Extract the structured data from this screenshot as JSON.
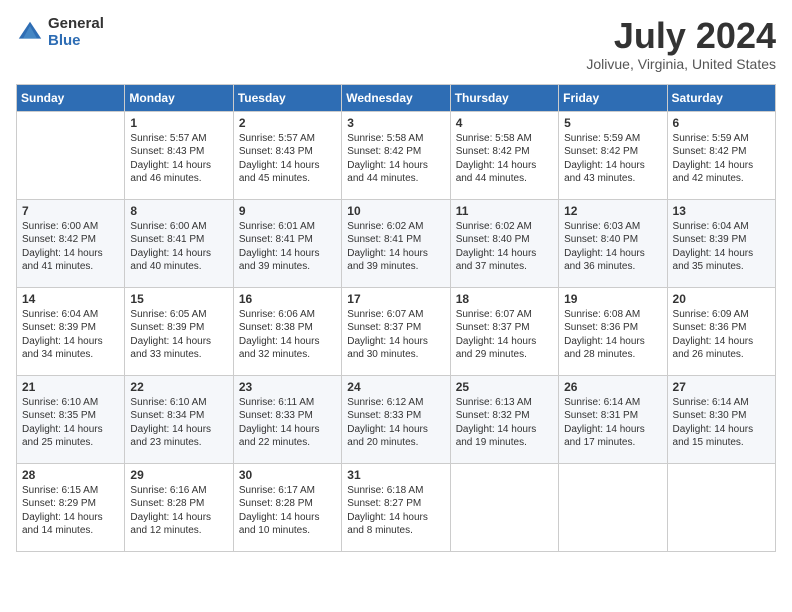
{
  "logo": {
    "text_general": "General",
    "text_blue": "Blue"
  },
  "title": "July 2024",
  "location": "Jolivue, Virginia, United States",
  "days_of_week": [
    "Sunday",
    "Monday",
    "Tuesday",
    "Wednesday",
    "Thursday",
    "Friday",
    "Saturday"
  ],
  "weeks": [
    [
      {
        "day": "",
        "info": ""
      },
      {
        "day": "1",
        "info": "Sunrise: 5:57 AM\nSunset: 8:43 PM\nDaylight: 14 hours\nand 46 minutes."
      },
      {
        "day": "2",
        "info": "Sunrise: 5:57 AM\nSunset: 8:43 PM\nDaylight: 14 hours\nand 45 minutes."
      },
      {
        "day": "3",
        "info": "Sunrise: 5:58 AM\nSunset: 8:42 PM\nDaylight: 14 hours\nand 44 minutes."
      },
      {
        "day": "4",
        "info": "Sunrise: 5:58 AM\nSunset: 8:42 PM\nDaylight: 14 hours\nand 44 minutes."
      },
      {
        "day": "5",
        "info": "Sunrise: 5:59 AM\nSunset: 8:42 PM\nDaylight: 14 hours\nand 43 minutes."
      },
      {
        "day": "6",
        "info": "Sunrise: 5:59 AM\nSunset: 8:42 PM\nDaylight: 14 hours\nand 42 minutes."
      }
    ],
    [
      {
        "day": "7",
        "info": ""
      },
      {
        "day": "8",
        "info": "Sunrise: 6:00 AM\nSunset: 8:41 PM\nDaylight: 14 hours\nand 40 minutes."
      },
      {
        "day": "9",
        "info": "Sunrise: 6:01 AM\nSunset: 8:41 PM\nDaylight: 14 hours\nand 39 minutes."
      },
      {
        "day": "10",
        "info": "Sunrise: 6:02 AM\nSunset: 8:41 PM\nDaylight: 14 hours\nand 39 minutes."
      },
      {
        "day": "11",
        "info": "Sunrise: 6:02 AM\nSunset: 8:40 PM\nDaylight: 14 hours\nand 37 minutes."
      },
      {
        "day": "12",
        "info": "Sunrise: 6:03 AM\nSunset: 8:40 PM\nDaylight: 14 hours\nand 36 minutes."
      },
      {
        "day": "13",
        "info": "Sunrise: 6:04 AM\nSunset: 8:39 PM\nDaylight: 14 hours\nand 35 minutes."
      }
    ],
    [
      {
        "day": "14",
        "info": ""
      },
      {
        "day": "15",
        "info": "Sunrise: 6:05 AM\nSunset: 8:39 PM\nDaylight: 14 hours\nand 33 minutes."
      },
      {
        "day": "16",
        "info": "Sunrise: 6:06 AM\nSunset: 8:38 PM\nDaylight: 14 hours\nand 32 minutes."
      },
      {
        "day": "17",
        "info": "Sunrise: 6:07 AM\nSunset: 8:37 PM\nDaylight: 14 hours\nand 30 minutes."
      },
      {
        "day": "18",
        "info": "Sunrise: 6:07 AM\nSunset: 8:37 PM\nDaylight: 14 hours\nand 29 minutes."
      },
      {
        "day": "19",
        "info": "Sunrise: 6:08 AM\nSunset: 8:36 PM\nDaylight: 14 hours\nand 28 minutes."
      },
      {
        "day": "20",
        "info": "Sunrise: 6:09 AM\nSunset: 8:36 PM\nDaylight: 14 hours\nand 26 minutes."
      }
    ],
    [
      {
        "day": "21",
        "info": ""
      },
      {
        "day": "22",
        "info": "Sunrise: 6:10 AM\nSunset: 8:34 PM\nDaylight: 14 hours\nand 23 minutes."
      },
      {
        "day": "23",
        "info": "Sunrise: 6:11 AM\nSunset: 8:33 PM\nDaylight: 14 hours\nand 22 minutes."
      },
      {
        "day": "24",
        "info": "Sunrise: 6:12 AM\nSunset: 8:33 PM\nDaylight: 14 hours\nand 20 minutes."
      },
      {
        "day": "25",
        "info": "Sunrise: 6:13 AM\nSunset: 8:32 PM\nDaylight: 14 hours\nand 19 minutes."
      },
      {
        "day": "26",
        "info": "Sunrise: 6:14 AM\nSunset: 8:31 PM\nDaylight: 14 hours\nand 17 minutes."
      },
      {
        "day": "27",
        "info": "Sunrise: 6:14 AM\nSunset: 8:30 PM\nDaylight: 14 hours\nand 15 minutes."
      }
    ],
    [
      {
        "day": "28",
        "info": ""
      },
      {
        "day": "29",
        "info": "Sunrise: 6:16 AM\nSunset: 8:28 PM\nDaylight: 14 hours\nand 12 minutes."
      },
      {
        "day": "30",
        "info": "Sunrise: 6:17 AM\nSunset: 8:28 PM\nDaylight: 14 hours\nand 10 minutes."
      },
      {
        "day": "31",
        "info": "Sunrise: 6:18 AM\nSunset: 8:27 PM\nDaylight: 14 hours\nand 8 minutes."
      },
      {
        "day": "",
        "info": ""
      },
      {
        "day": "",
        "info": ""
      },
      {
        "day": "",
        "info": ""
      }
    ]
  ],
  "week0_sunday_info": "Sunrise: 6:00 AM\nSunset: 8:42 PM\nDaylight: 14 hours\nand 41 minutes.",
  "week1_sunday_info": "Sunrise: 6:00 AM\nSunset: 8:42 PM\nDaylight: 14 hours\nand 41 minutes.",
  "week2_sunday_info": "Sunrise: 6:04 AM\nSunset: 8:39 PM\nDaylight: 14 hours\nand 34 minutes.",
  "week3_sunday_info": "Sunrise: 6:10 AM\nSunset: 8:35 PM\nDaylight: 14 hours\nand 25 minutes.",
  "week4_sunday_info": "Sunrise: 6:15 AM\nSunset: 8:29 PM\nDaylight: 14 hours\nand 14 minutes."
}
